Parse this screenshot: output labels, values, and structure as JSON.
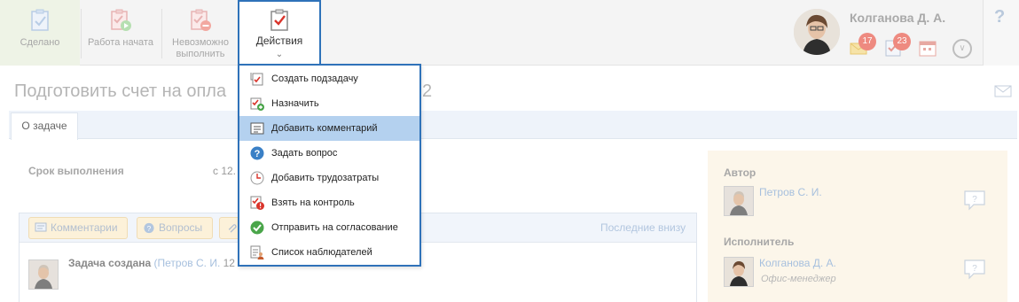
{
  "toolbar": {
    "done_label": "Сделано",
    "started_label": "Работа начата",
    "impossible_label_1": "Невозможно",
    "impossible_label_2": "выполнить",
    "actions_label": "Действия"
  },
  "user": {
    "name": "Колганова Д. А.",
    "badge_mail": "17",
    "badge_tasks": "23",
    "help": "?"
  },
  "task": {
    "title": "Подготовить счет на опла",
    "title_tail": "2",
    "tab": "О задаче",
    "deadline_label": "Срок выполнения",
    "deadline_value": "с 12."
  },
  "comments": {
    "btn_comments": "Комментарии",
    "btn_questions": "Вопросы",
    "last_below": "Последние внизу",
    "created_text": "Задача создана",
    "created_by": "Петров С. И.",
    "created_date": "12"
  },
  "right_panel": {
    "author_label": "Автор",
    "author_name": "Петров С. И.",
    "executor_label": "Исполнитель",
    "executor_name": "Колганова Д. А.",
    "executor_role": "Офис-менеджер"
  },
  "menu": {
    "items": [
      {
        "label": "Создать подзадачу",
        "icon": "subtask-icon"
      },
      {
        "label": "Назначить",
        "icon": "assign-icon"
      },
      {
        "label": "Добавить комментарий",
        "icon": "comment-icon"
      },
      {
        "label": "Задать вопрос",
        "icon": "question-icon"
      },
      {
        "label": "Добавить трудозатраты",
        "icon": "clock-icon"
      },
      {
        "label": "Взять на контроль",
        "icon": "control-icon"
      },
      {
        "label": "Отправить на согласование",
        "icon": "approve-icon"
      },
      {
        "label": "Список наблюдателей",
        "icon": "observers-icon"
      }
    ],
    "active_index": 2
  },
  "colors": {
    "accent_border": "#2f72b9",
    "active_item": "#b4d1ef",
    "badge": "#ee8a80"
  }
}
